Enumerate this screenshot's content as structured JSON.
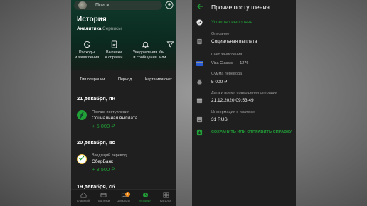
{
  "left_screen": {
    "search": {
      "placeholder": "Поиск"
    },
    "title": "История",
    "tabs": [
      {
        "label": "Аналитика",
        "active": true
      },
      {
        "label": "Сервисы",
        "active": false
      }
    ],
    "shortcuts": [
      {
        "icon": "chart-circle-icon",
        "line1": "Расходы",
        "line2": "и зачисления"
      },
      {
        "icon": "document-icon",
        "line1": "Выписки",
        "line2": "и справки"
      },
      {
        "icon": "bell-icon",
        "line1": "Уведомления",
        "line2": "и сообщения"
      },
      {
        "icon": "filter-icon",
        "line1": "Фи",
        "line2": "или"
      }
    ],
    "filters": [
      "Тип операции",
      "Период",
      "Карта или счет"
    ],
    "groups": [
      {
        "date": "21 декабря, пн",
        "transaction": {
          "icon": "sparkle-icon",
          "category": "Прочие поступления",
          "name": "Социальная выплата",
          "amount": "+ 5 000 ₽"
        }
      },
      {
        "date": "20 декабря, вс",
        "transaction": {
          "icon": "sberbank-icon",
          "category": "Входящий перевод",
          "name": "СберБанк",
          "amount": "+ 3 500 ₽"
        }
      },
      {
        "date": "19 декабря, сб"
      }
    ],
    "bottom_nav": [
      {
        "label": "Главный",
        "icon": "home-icon",
        "active": false
      },
      {
        "label": "Платежи",
        "icon": "payments-icon",
        "active": false
      },
      {
        "label": "Диалоги",
        "icon": "chat-icon",
        "active": false,
        "badge": "1"
      },
      {
        "label": "История",
        "icon": "clock-icon",
        "active": true
      },
      {
        "label": "Каталог",
        "icon": "catalog-icon",
        "active": false
      }
    ],
    "colors": {
      "accent": "#21a038",
      "header_bg": "#0f3a2b",
      "bg": "#1f1f1f",
      "badge": "#f08a1a"
    }
  },
  "right_screen": {
    "title": "Прочие поступления",
    "status": "Успешно выполнен",
    "fields": [
      {
        "icon": "document-icon",
        "label": "Описание",
        "value": "Социальная выплата"
      },
      {
        "icon": "card-icon",
        "label": "Счет зачисления",
        "value": "Visa Classic ···· 1276"
      },
      {
        "icon": "money-bag-icon",
        "label": "Сумма перевода",
        "value": "5 000 ₽"
      },
      {
        "icon": "calendar-icon",
        "label": "Дата и время совершения операции",
        "value": "21.12.2020 09:53:49"
      },
      {
        "icon": "info-icon",
        "label": "Информация о платеже",
        "value": "31 RUS"
      }
    ],
    "action": "СОХРАНИТЬ ИЛИ ОТПРАВИТЬ СПРАВКУ"
  }
}
